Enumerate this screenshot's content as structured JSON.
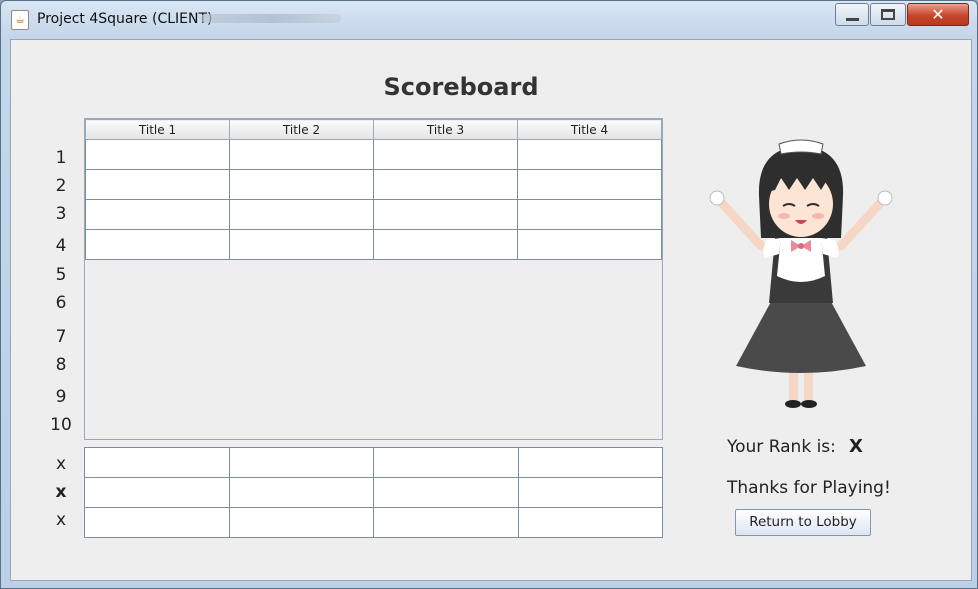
{
  "window": {
    "title": "Project 4Square (CLIENT)",
    "icon": "java-cup-icon",
    "controls": [
      "minimize",
      "maximize",
      "close"
    ]
  },
  "scoreboard": {
    "heading": "Scoreboard",
    "columns": [
      "Title 1",
      "Title 2",
      "Title 3",
      "Title 4"
    ],
    "row_numbers": [
      "1",
      "2",
      "3",
      "4",
      "5",
      "6",
      "7",
      "8",
      "9",
      "10"
    ],
    "bottom_row_labels": [
      "x",
      "x",
      "x"
    ]
  },
  "sidebar": {
    "rank_label": "Your Rank is:",
    "rank_value": "X",
    "thanks": "Thanks for Playing!",
    "return_button": "Return to Lobby"
  },
  "colors": {
    "title_bar": "#c4d6ea",
    "close_button": "#c7452b",
    "panel_bg": "#eeeeee",
    "grid_line": "#7c8ea3"
  }
}
